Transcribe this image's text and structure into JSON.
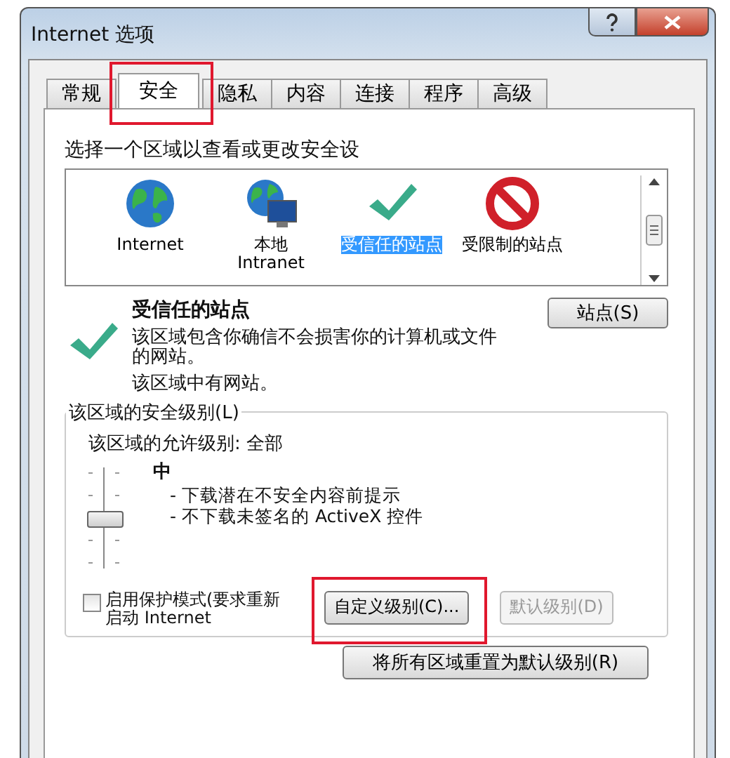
{
  "window": {
    "title": "Internet 选项"
  },
  "tabs": [
    {
      "label": "常规",
      "selected": false,
      "highlighted": false
    },
    {
      "label": "安全",
      "selected": true,
      "highlighted": true
    },
    {
      "label": "隐私",
      "selected": false,
      "highlighted": false
    },
    {
      "label": "内容",
      "selected": false,
      "highlighted": false
    },
    {
      "label": "连接",
      "selected": false,
      "highlighted": false
    },
    {
      "label": "程序",
      "selected": false,
      "highlighted": false
    },
    {
      "label": "高级",
      "selected": false,
      "highlighted": false
    }
  ],
  "zone_prompt": "选择一个区域以查看或更改安全设",
  "zones": [
    {
      "kind": "internet",
      "label": "Internet",
      "selected": false
    },
    {
      "kind": "intranet",
      "label": "本地 Intranet",
      "selected": false
    },
    {
      "kind": "trusted",
      "label": "受信任的站点",
      "selected": true
    },
    {
      "kind": "restricted",
      "label": "受限制的站点",
      "selected": false
    }
  ],
  "zone_detail": {
    "kind": "trusted",
    "title": "受信任的站点",
    "description": "该区域包含你确信不会损害你的计算机或文件的网站。",
    "note": "该区域中有网站。",
    "sites_button": "站点(S)"
  },
  "security_level": {
    "legend": "该区域的安全级别(L)",
    "allowed": "该区域的允许级别: 全部",
    "slider": {
      "level": 0.5
    },
    "level_name": "中",
    "bullets": [
      "- 下载潜在不安全内容前提示",
      "- 不下载未签名的 ActiveX 控件"
    ],
    "protected_mode": {
      "label": "启用保护模式(要求重新启动 Internet",
      "checked": false
    },
    "buttons": [
      {
        "label": "自定义级别(C)...",
        "disabled": false,
        "highlighted": true
      },
      {
        "label": "默认级别(D)",
        "disabled": true,
        "highlighted": false
      }
    ]
  },
  "reset_button": "将所有区域重置为默认级别(R)"
}
